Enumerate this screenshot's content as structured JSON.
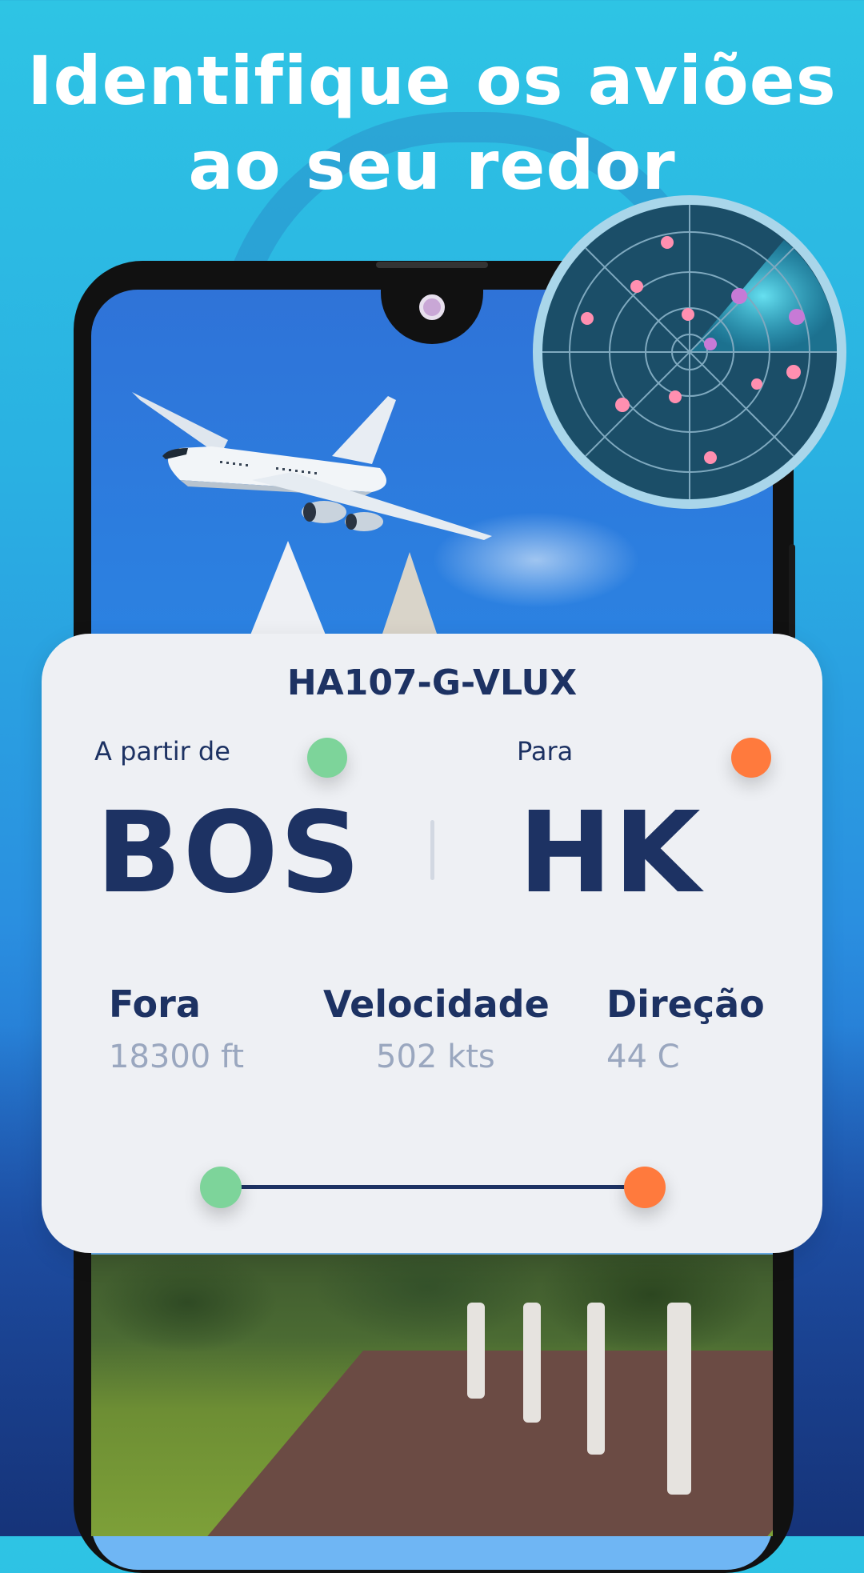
{
  "headline": {
    "line1": "Identifique os aviões",
    "line2": "ao seu redor"
  },
  "colors": {
    "background_top": "#2ec4e4",
    "card_bg": "#eef0f4",
    "text_primary": "#1d3263",
    "text_secondary": "#9aa7bf",
    "origin_dot": "#7dd49a",
    "destination_dot": "#ff7a3d",
    "radar_bg": "#1b4e68",
    "radar_blip": "#ff8fb0"
  },
  "flight_card": {
    "flight_id": "HA107-G-VLUX",
    "from_label": "A partir de",
    "to_label": "Para",
    "from_code": "BOS",
    "to_code": "HK",
    "stats": [
      {
        "title": "Fora",
        "value": "18300 ft"
      },
      {
        "title": "Velocidade",
        "value": "502 kts"
      },
      {
        "title": "Direção",
        "value": "44 C"
      }
    ],
    "progress": 1.0
  },
  "radar": {
    "icon": "radar-icon"
  }
}
